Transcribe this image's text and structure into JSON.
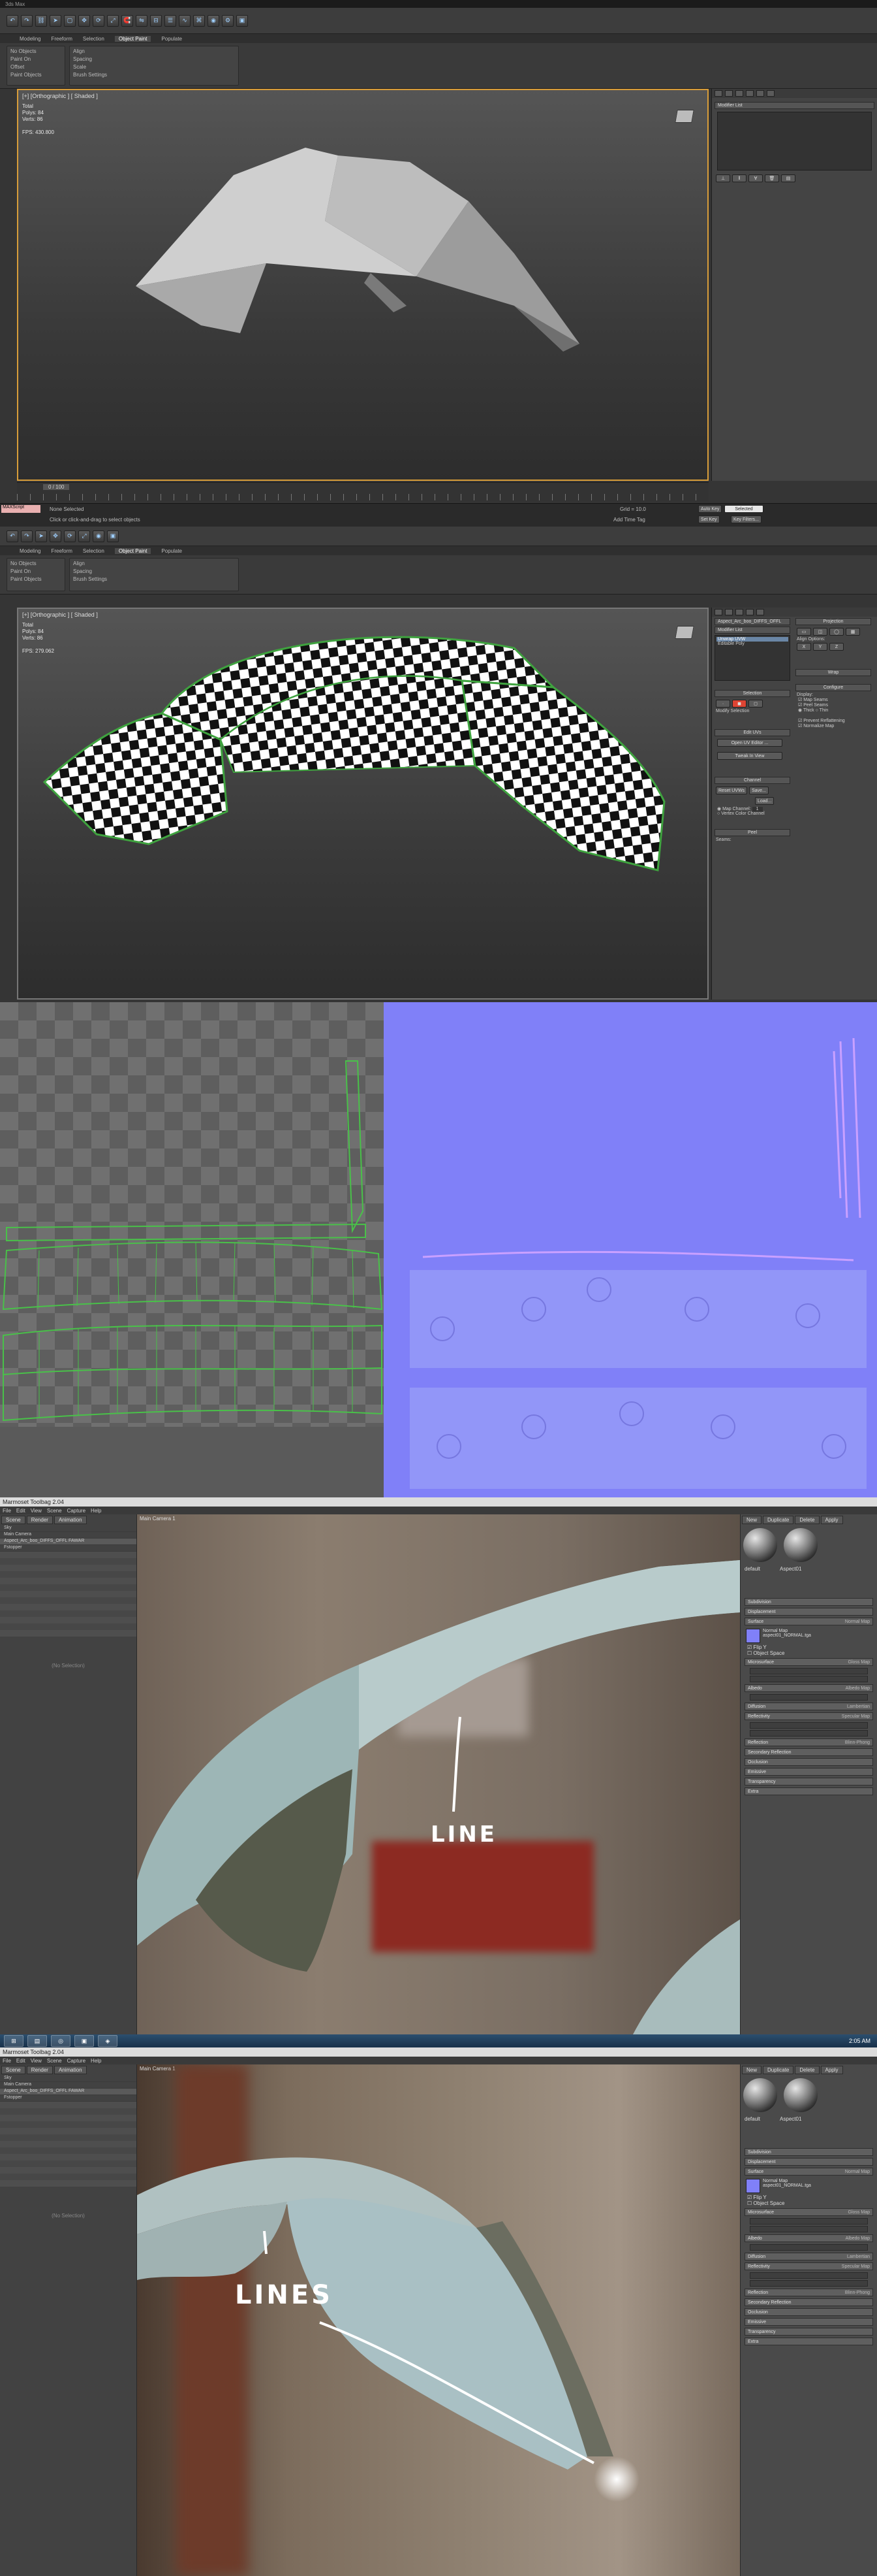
{
  "max1": {
    "title": "3ds Max",
    "ribbon_tabs": [
      "Modeling",
      "Freeform",
      "Selection",
      "Object Paint",
      "Populate"
    ],
    "active_tab": "Object Paint",
    "ribbon_groups": [
      {
        "label": "Paint Objects",
        "fields": [
          "No Objects",
          "Paint On",
          "Offset",
          "Fill",
          "Number"
        ]
      },
      {
        "label": "Brush Settings",
        "fields": [
          "Align",
          "Spacing",
          "Scale",
          "Rotate"
        ]
      }
    ],
    "viewport_label": "[+] [Orthographic ] [ Shaded ]",
    "stats": {
      "total_label": "Total",
      "polys_label": "Polys:",
      "polys": "84",
      "verts_label": "Verts:",
      "verts": "86",
      "fps_label": "FPS:",
      "fps": "430.800"
    },
    "command_panel": {
      "modifier_list": "Modifier List"
    },
    "timeline": {
      "frame": "0 / 100"
    },
    "status": {
      "selection": "None Selected",
      "hint": "Click or click-and-drag to select objects",
      "autokey": "Auto Key",
      "selected": "Selected",
      "setkey": "Set Key",
      "keyfilters": "Key Filters...",
      "add_time_tag": "Add Time Tag",
      "grid": "Grid = 10.0"
    }
  },
  "max2": {
    "viewport_label": "[+] [Orthographic ] [ Shaded ]",
    "stats": {
      "total_label": "Total",
      "polys_label": "Polys:",
      "polys": "84",
      "verts_label": "Verts:",
      "verts": "86",
      "fps_label": "FPS:",
      "fps": "279.062"
    },
    "command_panel": {
      "object_name": "Aspect_Arc_boo_DIFFS_OFFL",
      "modifier_list": "Modifier List",
      "stack": [
        "Unwrap UVW",
        "Editable Poly"
      ],
      "selection": "Selection",
      "modify_selection": "Modify Selection",
      "edit_uvs": "Edit UVs",
      "open_uv_editor": "Open UV Editor ...",
      "tweak_in_view": "Tweak In View",
      "channel": "Channel",
      "reset_uvws": "Reset UVWs",
      "save": "Save...",
      "load": "Load...",
      "map_channel": "Map Channel:",
      "map_channel_value": "1",
      "vertex_color_channel": "Vertex Color Channel",
      "peel": "Peel",
      "seams": "Seams:",
      "projection": "Projection",
      "align_options": "Align Options:",
      "wrap": "Wrap",
      "configure": "Configure",
      "display": "Display:",
      "map_seams": "Map Seams",
      "peel_seams": "Peel Seams",
      "thick": "Thick",
      "thin": "Thin",
      "prevent_reflattening": "Prevent Reflattening",
      "normalize_map": "Normalize Map"
    }
  },
  "marmoset1": {
    "title": "Marmoset Toolbag 2.04",
    "menu": [
      "File",
      "Edit",
      "View",
      "Scene",
      "Capture",
      "Help"
    ],
    "viewport_title": "Main Camera 1",
    "tabs": [
      "Scene",
      "Render",
      "Animation"
    ],
    "tree": [
      "Sky",
      "Main Camera",
      "Aspect_Arc_boo_DIFFS_OFFL FAWAR",
      "Fstopper"
    ],
    "no_selection": "(No Selection)",
    "material_tabs": [
      "New",
      "Duplicate",
      "Delete"
    ],
    "apply": "Apply",
    "materials": [
      "default",
      "Aspect01"
    ],
    "sections": [
      {
        "label": "Subdivision",
        "value": ""
      },
      {
        "label": "Displacement",
        "value": ""
      },
      {
        "label": "Surface",
        "value": "Normal Map"
      },
      {
        "label": "Microsurface",
        "value": "Gloss Map"
      },
      {
        "label": "Albedo",
        "value": "Albedo Map"
      },
      {
        "label": "Diffusion",
        "value": "Lambertian"
      },
      {
        "label": "Reflectivity",
        "value": "Specular Map"
      },
      {
        "label": "Reflection",
        "value": "Blinn-Phong"
      },
      {
        "label": "Secondary Reflection",
        "value": ""
      },
      {
        "label": "Occlusion",
        "value": ""
      },
      {
        "label": "Emissive",
        "value": ""
      },
      {
        "label": "Transparency",
        "value": ""
      },
      {
        "label": "Extra",
        "value": ""
      }
    ],
    "normal_map_label": "Normal Map",
    "normal_map_file": "aspect01_NORMAL.tga",
    "flip_y": "Flip Y",
    "object_space": "Object Space",
    "annotation": "LINE"
  },
  "marmoset2": {
    "annotation": "LINES",
    "viewport_title": "Main Camera 1",
    "time": "2:05 AM"
  }
}
